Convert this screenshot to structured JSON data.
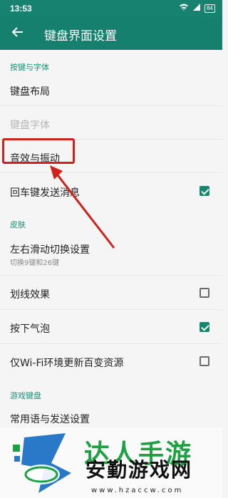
{
  "status_bar": {
    "time": "13:53",
    "battery": "84"
  },
  "app_bar": {
    "title": "键盘界面设置"
  },
  "sections": {
    "keys_fonts": "按键与字体",
    "skin": "皮肤",
    "game_keyboard": "游戏键盘"
  },
  "rows": {
    "keyboard_layout": "键盘布局",
    "keyboard_font": "键盘字体",
    "sound_vibration": "音效与振动",
    "enter_send": "回车键发送消息",
    "swipe_switch": "左右滑动切换设置",
    "swipe_switch_sub": "切换9键和26键",
    "swipe_effect": "划线效果",
    "press_bubble": "按下气泡",
    "wifi_update": "仅Wi-Fi环境更新百变资源",
    "common_phrases": "常用语与发送设置"
  },
  "checkbox_states": {
    "enter_send": true,
    "swipe_effect": false,
    "press_bubble": true,
    "wifi_update": false
  },
  "watermark": {
    "top_text": "达人手游",
    "bottom_text": "安勤游戏网",
    "url": "www.hzaccw.com"
  },
  "colors": {
    "accent": "#15876f",
    "annotation": "#d0221d"
  }
}
